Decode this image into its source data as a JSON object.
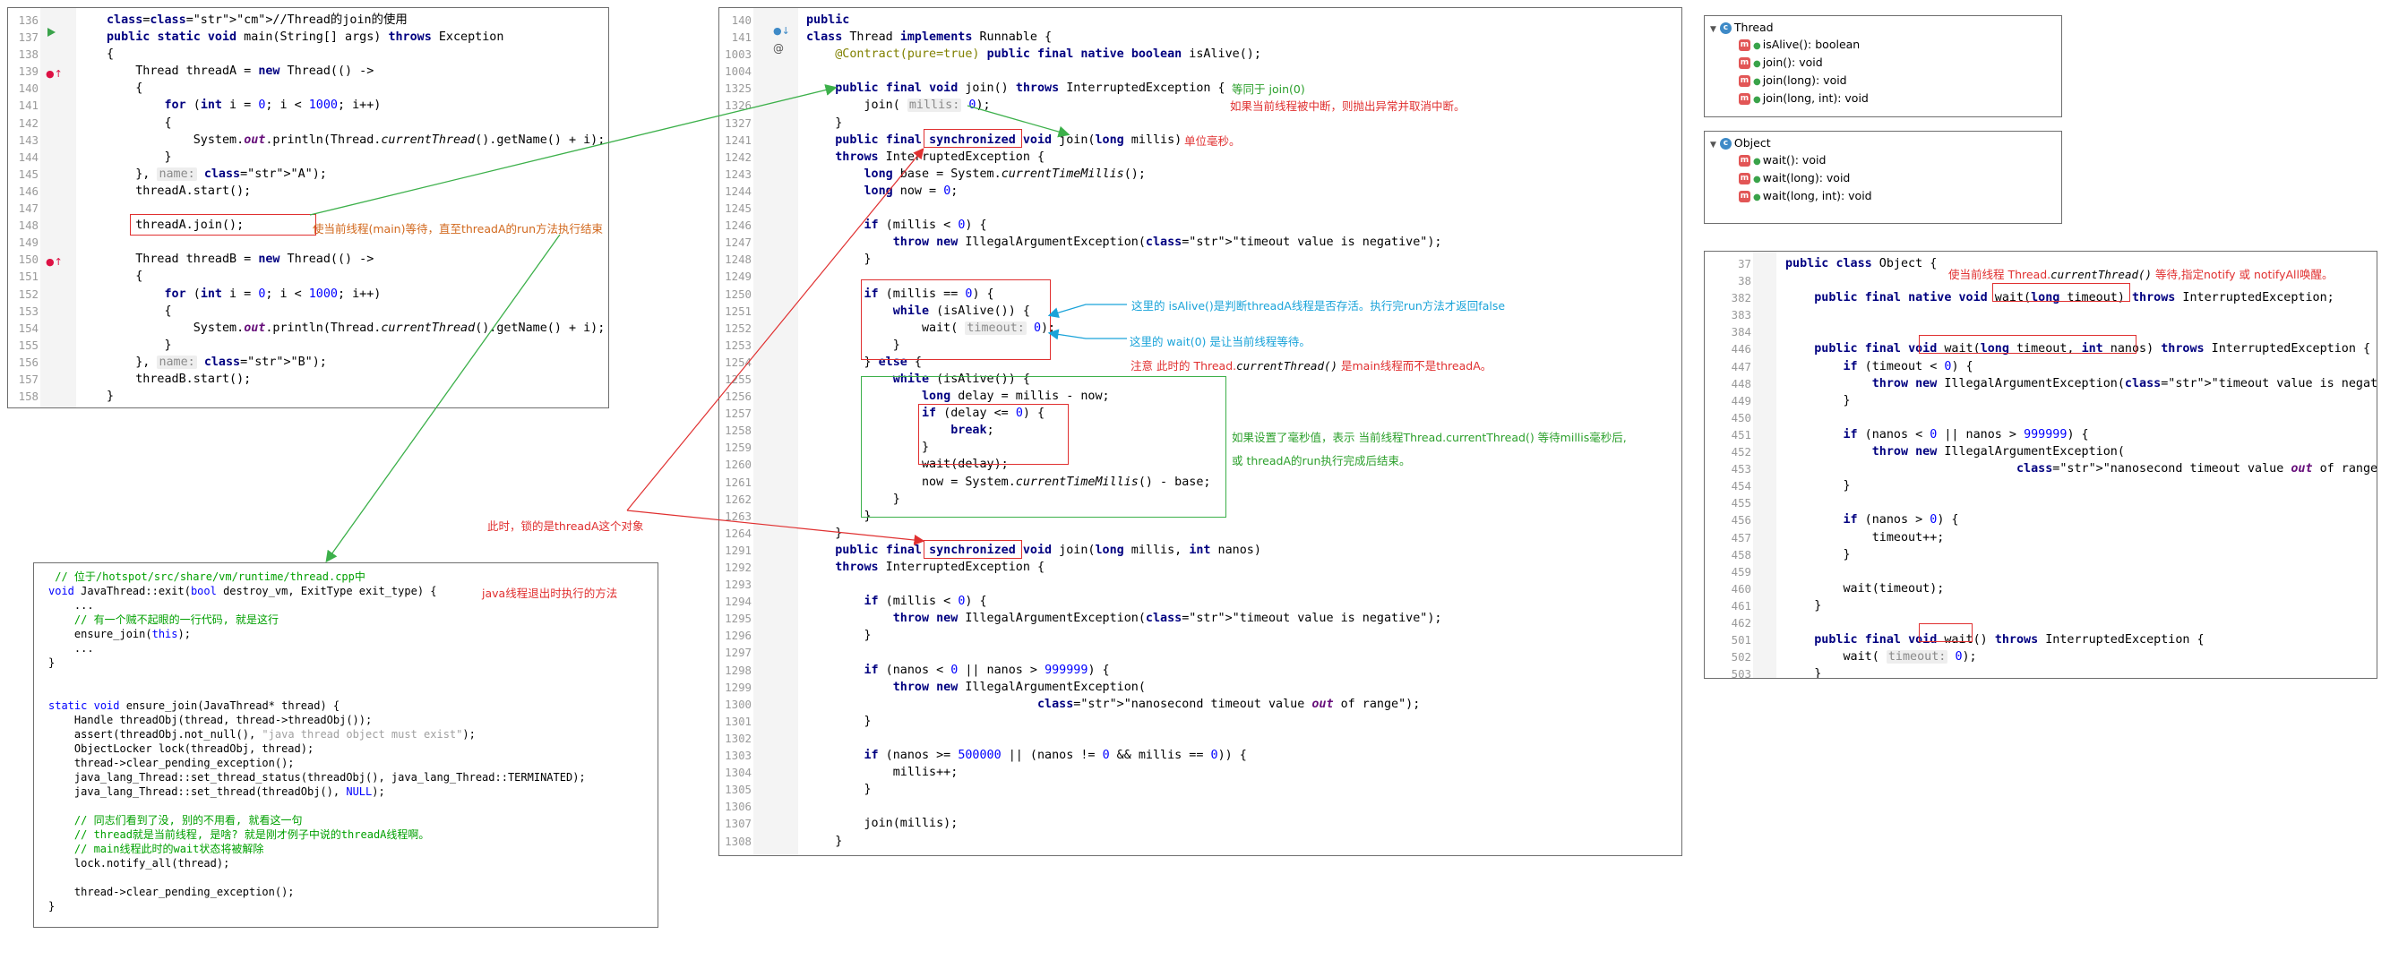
{
  "panel_main_code": {
    "lines": [
      {
        "no": "136",
        "t": "//Thread的join的使用"
      },
      {
        "no": "137",
        "t": "public static void main(String[] args) throws Exception"
      },
      {
        "no": "138",
        "t": "{"
      },
      {
        "no": "139",
        "t": "    Thread threadA = new Thread(() ->"
      },
      {
        "no": "140",
        "t": "    {"
      },
      {
        "no": "141",
        "t": "        for (int i = 0; i < 1000; i++)"
      },
      {
        "no": "142",
        "t": "        {"
      },
      {
        "no": "143",
        "t": "            System.out.println(Thread.currentThread().getName() + i);"
      },
      {
        "no": "144",
        "t": "        }"
      },
      {
        "no": "145",
        "t": "    }, name: \"A\");"
      },
      {
        "no": "146",
        "t": "    threadA.start();"
      },
      {
        "no": "147",
        "t": ""
      },
      {
        "no": "148",
        "t": "    threadA.join();"
      },
      {
        "no": "149",
        "t": ""
      },
      {
        "no": "150",
        "t": "    Thread threadB = new Thread(() ->"
      },
      {
        "no": "151",
        "t": "    {"
      },
      {
        "no": "152",
        "t": "        for (int i = 0; i < 1000; i++)"
      },
      {
        "no": "153",
        "t": "        {"
      },
      {
        "no": "154",
        "t": "            System.out.println(Thread.currentThread().getName() + i);"
      },
      {
        "no": "155",
        "t": "        }"
      },
      {
        "no": "156",
        "t": "    }, name: \"B\");"
      },
      {
        "no": "157",
        "t": "    threadB.start();"
      },
      {
        "no": "158",
        "t": "}"
      }
    ],
    "note_join": "使当前线程(main)等待，直至threadA的run方法执行结束"
  },
  "panel_thread_source": {
    "lines": [
      {
        "no": "140",
        "t": "public"
      },
      {
        "no": "141",
        "t": "class Thread implements Runnable {"
      },
      {
        "no": "1003",
        "t": "    @Contract(pure=true) public final native boolean isAlive();"
      },
      {
        "no": "1004",
        "t": ""
      },
      {
        "no": "1325",
        "t": "    public final void join() throws InterruptedException {"
      },
      {
        "no": "1326",
        "t": "        join( millis: 0);"
      },
      {
        "no": "1327",
        "t": "    }"
      },
      {
        "no": "1241",
        "t": "    public final synchronized void join(long millis)"
      },
      {
        "no": "1242",
        "t": "    throws InterruptedException {"
      },
      {
        "no": "1243",
        "t": "        long base = System.currentTimeMillis();"
      },
      {
        "no": "1244",
        "t": "        long now = 0;"
      },
      {
        "no": "1245",
        "t": ""
      },
      {
        "no": "1246",
        "t": "        if (millis < 0) {"
      },
      {
        "no": "1247",
        "t": "            throw new IllegalArgumentException(\"timeout value is negative\");"
      },
      {
        "no": "1248",
        "t": "        }"
      },
      {
        "no": "1249",
        "t": ""
      },
      {
        "no": "1250",
        "t": "        if (millis == 0) {"
      },
      {
        "no": "1251",
        "t": "            while (isAlive()) {"
      },
      {
        "no": "1252",
        "t": "                wait( timeout: 0);"
      },
      {
        "no": "1253",
        "t": "            }"
      },
      {
        "no": "1254",
        "t": "        } else {"
      },
      {
        "no": "1255",
        "t": "            while (isAlive()) {"
      },
      {
        "no": "1256",
        "t": "                long delay = millis - now;"
      },
      {
        "no": "1257",
        "t": "                if (delay <= 0) {"
      },
      {
        "no": "1258",
        "t": "                    break;"
      },
      {
        "no": "1259",
        "t": "                }"
      },
      {
        "no": "1260",
        "t": "                wait(delay);"
      },
      {
        "no": "1261",
        "t": "                now = System.currentTimeMillis() - base;"
      },
      {
        "no": "1262",
        "t": "            }"
      },
      {
        "no": "1263",
        "t": "        }"
      },
      {
        "no": "1264",
        "t": "    }"
      },
      {
        "no": "1291",
        "t": "    public final synchronized void join(long millis, int nanos)"
      },
      {
        "no": "1292",
        "t": "    throws InterruptedException {"
      },
      {
        "no": "1293",
        "t": ""
      },
      {
        "no": "1294",
        "t": "        if (millis < 0) {"
      },
      {
        "no": "1295",
        "t": "            throw new IllegalArgumentException(\"timeout value is negative\");"
      },
      {
        "no": "1296",
        "t": "        }"
      },
      {
        "no": "1297",
        "t": ""
      },
      {
        "no": "1298",
        "t": "        if (nanos < 0 || nanos > 999999) {"
      },
      {
        "no": "1299",
        "t": "            throw new IllegalArgumentException("
      },
      {
        "no": "1300",
        "t": "                                \"nanosecond timeout value out of range\");"
      },
      {
        "no": "1301",
        "t": "        }"
      },
      {
        "no": "1302",
        "t": ""
      },
      {
        "no": "1303",
        "t": "        if (nanos >= 500000 || (nanos != 0 && millis == 0)) {"
      },
      {
        "no": "1304",
        "t": "            millis++;"
      },
      {
        "no": "1305",
        "t": "        }"
      },
      {
        "no": "1306",
        "t": ""
      },
      {
        "no": "1307",
        "t": "        join(millis);"
      },
      {
        "no": "1308",
        "t": "    }"
      }
    ],
    "note_join0": "等同于 join(0)",
    "note_interrupt": "如果当前线程被中断，则抛出异常并取消中断。",
    "note_unit": "单位毫秒。",
    "note_isalive": "这里的 isAlive()是判断threadA线程是否存活。执行完run方法才返回false",
    "note_wait0": "这里的 wait(0) 是让当前线程等待。",
    "note_attention_a": "注意 此时的 Thread.",
    "note_attention_b": "currentThread()",
    "note_attention_c": " 是main线程而不是threadA。",
    "note_millis_1": "如果设置了毫秒值，表示 当前线程Thread.currentThread() 等待millis毫秒后,",
    "note_millis_2": "或 threadA的run执行完成后结束。",
    "note_lock": "此时，锁的是threadA这个对象"
  },
  "panel_cpp": {
    "lines": [
      {
        "t": " // 位于/hotspot/src/share/vm/runtime/thread.cpp中"
      },
      {
        "t": "void JavaThread::exit(bool destroy_vm, ExitType exit_type) {"
      },
      {
        "t": "    ..."
      },
      {
        "t": "    // 有一个贼不起眼的一行代码, 就是这行"
      },
      {
        "t": "    ensure_join(this);"
      },
      {
        "t": "    ..."
      },
      {
        "t": "}"
      },
      {
        "t": ""
      },
      {
        "t": ""
      },
      {
        "t": "static void ensure_join(JavaThread* thread) {"
      },
      {
        "t": "    Handle threadObj(thread, thread->threadObj());"
      },
      {
        "t": "    assert(threadObj.not_null(), \"java thread object must exist\");"
      },
      {
        "t": "    ObjectLocker lock(threadObj, thread);"
      },
      {
        "t": "    thread->clear_pending_exception();"
      },
      {
        "t": "    java_lang_Thread::set_thread_status(threadObj(), java_lang_Thread::TERMINATED);"
      },
      {
        "t": "    java_lang_Thread::set_thread(threadObj(), NULL);"
      },
      {
        "t": ""
      },
      {
        "t": "    // 同志们看到了没, 别的不用看, 就看这一句"
      },
      {
        "t": "    // thread就是当前线程, 是啥? 就是刚才例子中说的threadA线程啊。"
      },
      {
        "t": "    // main线程此时的wait状态将被解除"
      },
      {
        "t": "    lock.notify_all(thread);"
      },
      {
        "t": ""
      },
      {
        "t": "    thread->clear_pending_exception();"
      },
      {
        "t": "}"
      }
    ],
    "note_exit": "java线程退出时执行的方法"
  },
  "structure_thread": {
    "title": "Thread",
    "items": [
      "isAlive(): boolean",
      "join(): void",
      "join(long): void",
      "join(long, int): void"
    ]
  },
  "structure_object": {
    "title": "Object",
    "items": [
      "wait(): void",
      "wait(long): void",
      "wait(long, int): void"
    ]
  },
  "panel_object_source": {
    "lines": [
      {
        "no": "37",
        "t": "public class Object {"
      },
      {
        "no": "38",
        "t": ""
      },
      {
        "no": "382",
        "t": "    public final native void wait(long timeout) throws InterruptedException;"
      },
      {
        "no": "383",
        "t": ""
      },
      {
        "no": "384",
        "t": ""
      },
      {
        "no": "446",
        "t": "    public final void wait(long timeout, int nanos) throws InterruptedException {"
      },
      {
        "no": "447",
        "t": "        if (timeout < 0) {"
      },
      {
        "no": "448",
        "t": "            throw new IllegalArgumentException(\"timeout value is negative\");"
      },
      {
        "no": "449",
        "t": "        }"
      },
      {
        "no": "450",
        "t": ""
      },
      {
        "no": "451",
        "t": "        if (nanos < 0 || nanos > 999999) {"
      },
      {
        "no": "452",
        "t": "            throw new IllegalArgumentException("
      },
      {
        "no": "453",
        "t": "                                \"nanosecond timeout value out of range\");"
      },
      {
        "no": "454",
        "t": "        }"
      },
      {
        "no": "455",
        "t": ""
      },
      {
        "no": "456",
        "t": "        if (nanos > 0) {"
      },
      {
        "no": "457",
        "t": "            timeout++;"
      },
      {
        "no": "458",
        "t": "        }"
      },
      {
        "no": "459",
        "t": ""
      },
      {
        "no": "460",
        "t": "        wait(timeout);"
      },
      {
        "no": "461",
        "t": "    }"
      },
      {
        "no": "462",
        "t": ""
      },
      {
        "no": "501",
        "t": "    public final void wait() throws InterruptedException {"
      },
      {
        "no": "502",
        "t": "        wait( timeout: 0);"
      },
      {
        "no": "503",
        "t": "    }"
      }
    ],
    "note_wait_a": "使当前线程 Thread.",
    "note_wait_b": "currentThread()",
    "note_wait_c": " 等待,指定notify 或 notifyAll唤醒。"
  },
  "colors": {
    "annotation_red": "#e03030",
    "annotation_green": "#2ca02c",
    "annotation_cyan": "#1aa3d9",
    "keyword": "#000080",
    "string": "#008000",
    "number": "#0000ff"
  }
}
